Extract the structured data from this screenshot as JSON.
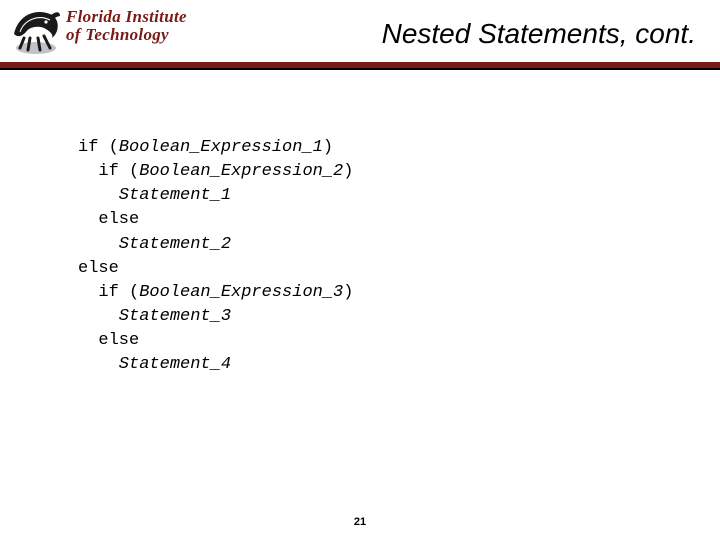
{
  "header": {
    "inst_line1": "Florida Institute",
    "inst_line2": "of Technology",
    "title": "Nested Statements, cont."
  },
  "code": {
    "l1": {
      "kw": "if (",
      "it": "Boolean_Expression_1",
      "tail": ")"
    },
    "l2": {
      "kw": "  if (",
      "it": "Boolean_Expression_2",
      "tail": ")"
    },
    "l3": {
      "it": "    Statement_1"
    },
    "l4": {
      "kw": "  else"
    },
    "l5": {
      "it": "    Statement_2"
    },
    "l6": {
      "kw": "else"
    },
    "l7": {
      "kw": "  if (",
      "it": "Boolean_Expression_3",
      "tail": ")"
    },
    "l8": {
      "it": "    Statement_3"
    },
    "l9": {
      "kw": "  else"
    },
    "l10": {
      "it": "    Statement_4"
    }
  },
  "page_number": "21"
}
